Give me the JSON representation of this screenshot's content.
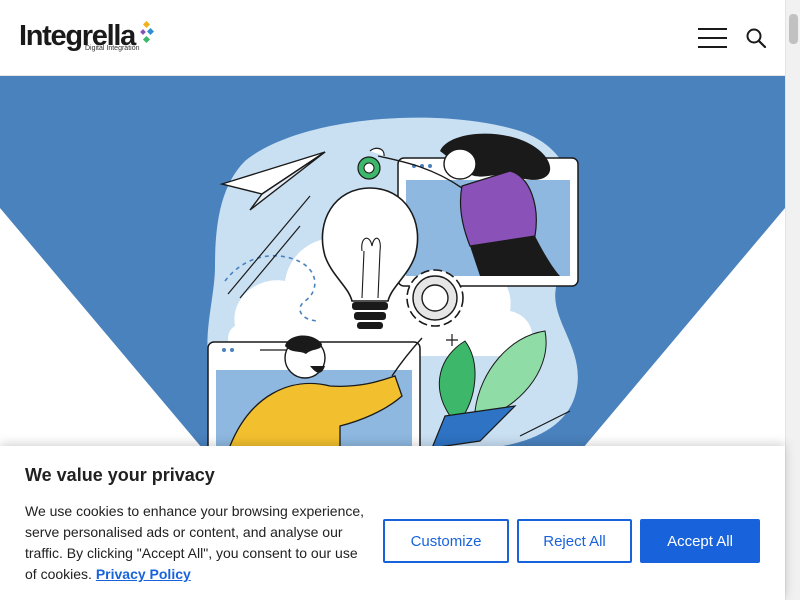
{
  "header": {
    "logo_text": "Integrella",
    "logo_tagline": "Digital Integration",
    "menu_icon": "hamburger-menu-icon",
    "search_icon": "search-icon"
  },
  "hero": {
    "background_color": "#4a82be",
    "illustration": "idea-collaboration-illustration"
  },
  "cookie_banner": {
    "title": "We value your privacy",
    "text": "We use cookies to enhance your browsing experience, serve personalised ads or content, and analyse our traffic. By clicking \"Accept All\", you consent to our use of cookies.",
    "policy_link": "Privacy Policy",
    "customize_label": "Customize",
    "reject_label": "Reject All",
    "accept_label": "Accept All",
    "accent_color": "#1863dc"
  }
}
